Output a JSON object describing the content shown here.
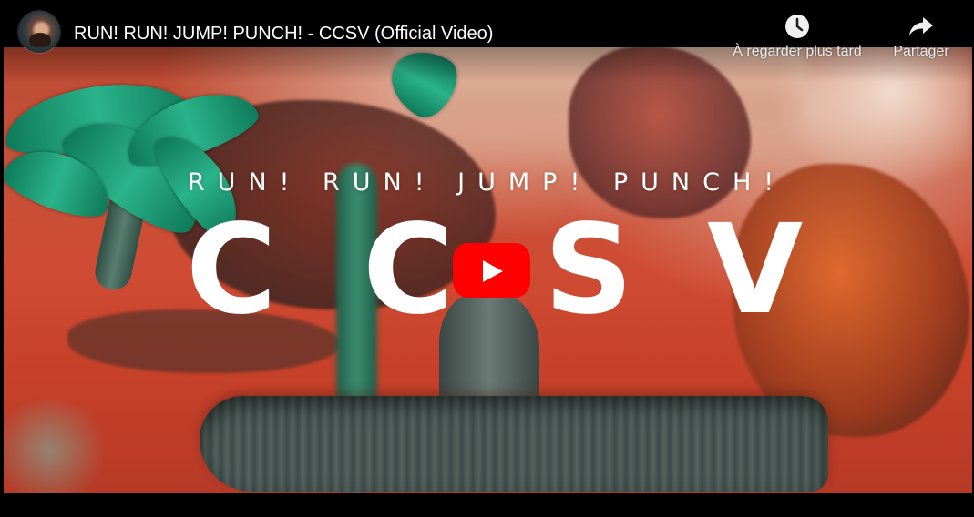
{
  "player": {
    "title": "RUN! RUN! JUMP! PUNCH! - CCSV (Official Video)",
    "actions": {
      "watch_later_label": "À regarder plus tard",
      "share_label": "Partager"
    },
    "thumbnail": {
      "subtitle": "RUN! RUN! JUMP! PUNCH!",
      "letters": [
        "C",
        "C",
        "S",
        "V"
      ]
    },
    "icons": {
      "watch_later": "clock-icon",
      "share": "share-arrow-icon",
      "play": "play-icon"
    },
    "colors": {
      "play_button": "#ff0000",
      "title_text": "#ffffff"
    }
  }
}
